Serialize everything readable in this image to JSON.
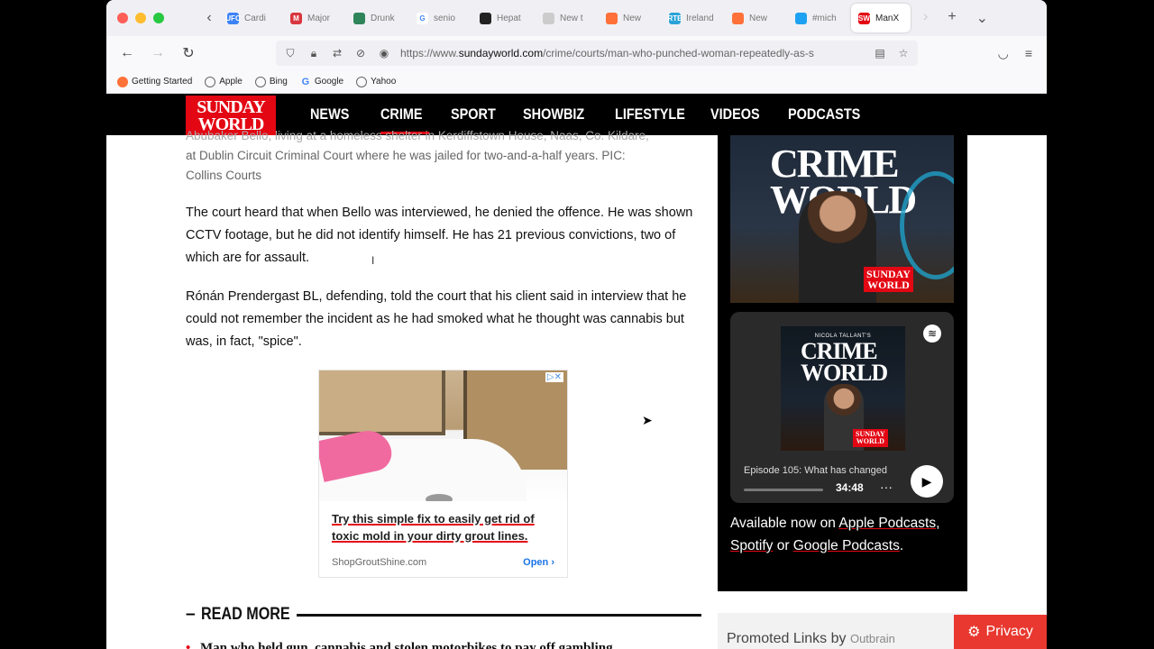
{
  "browser": {
    "tabs": [
      {
        "label": "Cardi",
        "fav": "UFC",
        "color": "#3b82f6"
      },
      {
        "label": "Major",
        "fav": "M",
        "color": "#d9363e"
      },
      {
        "label": "Drunk",
        "fav": "",
        "color": "#2f855a"
      },
      {
        "label": "senio",
        "fav": "G",
        "color": "#ffffff"
      },
      {
        "label": "Hepat",
        "fav": "",
        "color": "#222222"
      },
      {
        "label": "New t",
        "fav": "",
        "color": "#cccccc"
      },
      {
        "label": "New",
        "fav": "",
        "color": "#ff7139"
      },
      {
        "label": "Ireland",
        "fav": "RTE",
        "color": "#2aa3d8"
      },
      {
        "label": "New",
        "fav": "",
        "color": "#ff7139"
      },
      {
        "label": "#mich",
        "fav": "",
        "color": "#1da1f2"
      },
      {
        "label": "ManX",
        "fav": "SW",
        "color": "#e30613"
      }
    ],
    "url_prefix": "https://www.",
    "url_domain": "sundayworld.com",
    "url_path": "/crime/courts/man-who-punched-woman-repeatedly-as-s",
    "bookmarks": [
      "Getting Started",
      "Apple",
      "Bing",
      "Google",
      "Yahoo"
    ]
  },
  "site": {
    "logo_line1": "SUNDAY",
    "logo_line2": "WORLD",
    "menu": [
      "NEWS",
      "CRIME",
      "SPORT",
      "SHOWBIZ",
      "LIFESTYLE",
      "VIDEOS",
      "PODCASTS"
    ],
    "active_menu": "CRIME"
  },
  "article": {
    "caption_line1": "Abubaker Bello, living at a homeless shelter in Kerdiffstown House, Naas, Co. Kildare,",
    "caption_line2": "at Dublin Circuit Criminal Court where he was jailed for two-and-a-half years. PIC:",
    "caption_line3": "Collins Courts",
    "para1": "The court heard that when Bello was interviewed, he denied the offence. He was shown CCTV footage, but he did not identify himself. He has 21 previous convictions, two of which are for assault.",
    "para2": "Rónán Prendergast BL, defending, told the court that his client said in interview that he could not remember the incident as he had smoked what he thought was cannabis but was, in fact, \"spice\".",
    "read_more": "READ MORE",
    "read_more_item": "Man who held gun, cannabis and stolen motorbikes to pay off gambling"
  },
  "ad": {
    "title": "Try this simple fix to easily get rid of toxic mold in your dirty grout lines.",
    "source": "ShopGroutShine.com",
    "cta": "Open"
  },
  "sidebar": {
    "banner_title1": "CRIME",
    "banner_title2": "WORLD",
    "badge1": "SUNDAY",
    "badge2": "WORLD",
    "cover_small": "NICOLA TALLANT'S",
    "cover_title1": "CRIME",
    "cover_title2": "WORLD",
    "episode": "Episode 105: What has changed",
    "duration": "34:48",
    "available_prefix": "Available now on ",
    "apple": "Apple Podcasts",
    "sep1": ", ",
    "spotify": "Spotify",
    "sep2": " or ",
    "google": "Google Podcasts",
    "suffix": "."
  },
  "promoted": "Promoted Links by",
  "outbrain": "Outbrain",
  "privacy": "Privacy"
}
